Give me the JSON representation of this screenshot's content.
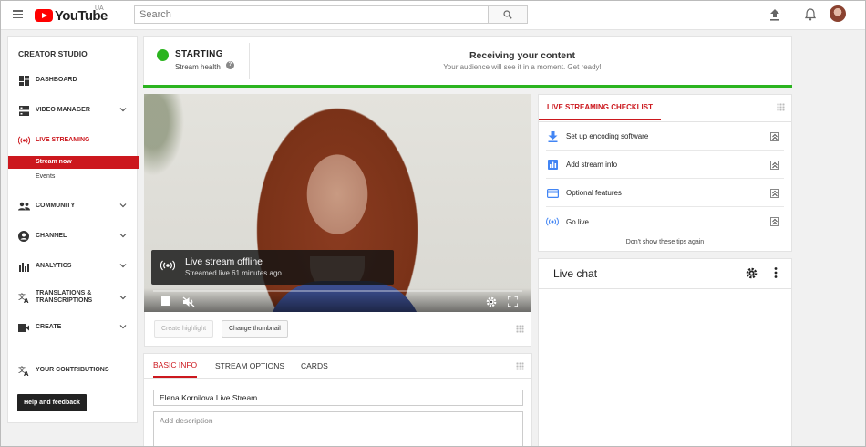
{
  "header": {
    "logo_text": "YouTube",
    "logo_region": "UA",
    "search_placeholder": "Search"
  },
  "sidebar": {
    "title": "CREATOR STUDIO",
    "items": [
      {
        "label": "DASHBOARD",
        "icon": "dashboard-icon"
      },
      {
        "label": "VIDEO MANAGER",
        "icon": "video-manager-icon"
      },
      {
        "label": "LIVE STREAMING",
        "icon": "live-streaming-icon"
      },
      {
        "label": "COMMUNITY",
        "icon": "community-icon"
      },
      {
        "label": "CHANNEL",
        "icon": "channel-icon"
      },
      {
        "label": "ANALYTICS",
        "icon": "analytics-icon"
      },
      {
        "label": "TRANSLATIONS &",
        "label2": "TRANSCRIPTIONS",
        "icon": "translations-icon"
      },
      {
        "label": "CREATE",
        "icon": "create-icon"
      },
      {
        "label": "YOUR CONTRIBUTIONS",
        "icon": "contributions-icon"
      }
    ],
    "live_sub_items": [
      "Stream now",
      "Events"
    ],
    "help_button": "Help and feedback"
  },
  "status": {
    "state": "STARTING",
    "health_label": "Stream health",
    "help_glyph": "?",
    "receiving_title": "Receiving your content",
    "receiving_subtitle": "Your audience will see it in a moment. Get ready!",
    "progress": 1.0,
    "accent": "#2bb41f"
  },
  "player": {
    "overlay_title": "Live stream offline",
    "overlay_subtitle": "Streamed live 61 minutes ago",
    "create_highlight": "Create highlight",
    "change_thumbnail": "Change thumbnail"
  },
  "info": {
    "tabs": [
      "BASIC INFO",
      "STREAM OPTIONS",
      "CARDS"
    ],
    "title_value": "Elena Kornilova Live Stream",
    "description_placeholder": "Add description"
  },
  "checklist": {
    "title": "LIVE STREAMING CHECKLIST",
    "items": [
      {
        "label": "Set up encoding software",
        "icon": "download-icon"
      },
      {
        "label": "Add stream info",
        "icon": "bar-chart-icon"
      },
      {
        "label": "Optional features",
        "icon": "card-icon"
      },
      {
        "label": "Go live",
        "icon": "live-icon"
      }
    ],
    "dismiss": "Don't show these tips again"
  },
  "chat": {
    "title": "Live chat"
  },
  "colors": {
    "brand_red": "#cc181e",
    "logo_red": "#ff0000",
    "accent_blue": "#4285f4"
  }
}
